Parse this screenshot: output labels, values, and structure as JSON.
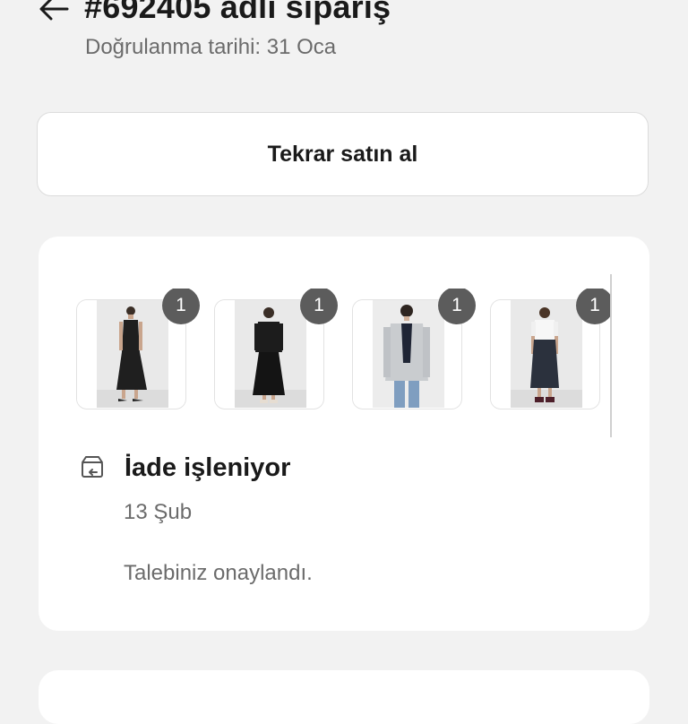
{
  "header": {
    "title": "#692405 adlı sipariş",
    "subtitle": "Doğrulanma tarihi: 31 Oca",
    "back_icon": "arrow-left-icon"
  },
  "actions": {
    "rebuy_label": "Tekrar satın al"
  },
  "order_card": {
    "items": [
      {
        "quantity": "1",
        "description": "black sleeveless maxi dress"
      },
      {
        "quantity": "1",
        "description": "black top and long skirt"
      },
      {
        "quantity": "1",
        "description": "grey jacket with jeans"
      },
      {
        "quantity": "1",
        "description": "white tee and dark denim skirt"
      }
    ],
    "status_icon": "return-box-icon",
    "status_title": "İade işleniyor",
    "status_date": "13 Şub",
    "status_message": "Talebiniz onaylandı."
  },
  "colors": {
    "background": "#f2f2f2",
    "card": "#ffffff",
    "badge": "#5c5c5c"
  }
}
